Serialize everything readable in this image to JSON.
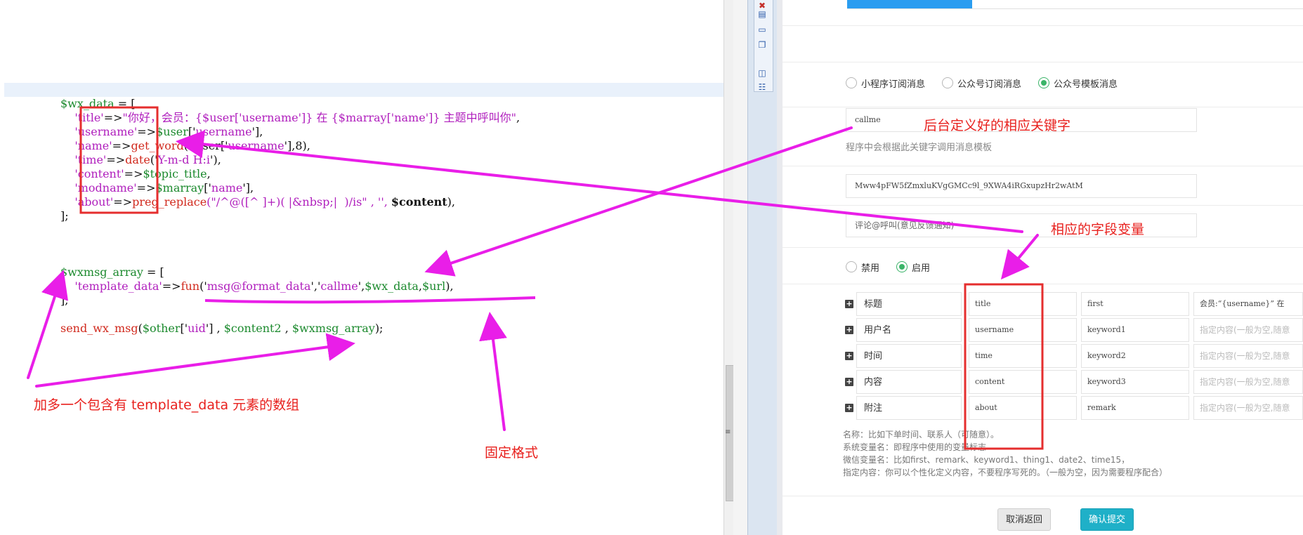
{
  "code": {
    "lines": [
      [
        {
          "t": "$wx_data",
          "c": "c-var"
        },
        {
          "t": " = [",
          "c": "c-op"
        }
      ],
      [
        {
          "t": "    ",
          "c": "c-op"
        },
        {
          "t": "'title'",
          "c": "c-key"
        },
        {
          "t": "=>",
          "c": "c-op"
        },
        {
          "t": "\"你好，会员：{$user['username']} 在 {$marray['name']} 主题中呼叫你\"",
          "c": "c-str"
        },
        {
          "t": ",",
          "c": "c-op"
        }
      ],
      [
        {
          "t": "    ",
          "c": "c-op"
        },
        {
          "t": "'username'",
          "c": "c-key"
        },
        {
          "t": "=>",
          "c": "c-op"
        },
        {
          "t": "$user",
          "c": "c-var"
        },
        {
          "t": "['",
          "c": "c-op"
        },
        {
          "t": "username",
          "c": "c-key"
        },
        {
          "t": "'],",
          "c": "c-op"
        }
      ],
      [
        {
          "t": "    ",
          "c": "c-op"
        },
        {
          "t": "'name'",
          "c": "c-key"
        },
        {
          "t": "=>",
          "c": "c-op"
        },
        {
          "t": "get_word",
          "c": "c-fn"
        },
        {
          "t": "($user['",
          "c": "c-op"
        },
        {
          "t": "username",
          "c": "c-key"
        },
        {
          "t": "'],8),",
          "c": "c-op"
        }
      ],
      [
        {
          "t": "    ",
          "c": "c-op"
        },
        {
          "t": "'time'",
          "c": "c-key"
        },
        {
          "t": "=>",
          "c": "c-op"
        },
        {
          "t": "date",
          "c": "c-fn"
        },
        {
          "t": "('",
          "c": "c-op"
        },
        {
          "t": "Y-m-d H:i",
          "c": "c-key"
        },
        {
          "t": "'),",
          "c": "c-op"
        }
      ],
      [
        {
          "t": "    ",
          "c": "c-op"
        },
        {
          "t": "'content'",
          "c": "c-key"
        },
        {
          "t": "=>",
          "c": "c-op"
        },
        {
          "t": "$topic_title",
          "c": "c-var"
        },
        {
          "t": ",",
          "c": "c-op"
        }
      ],
      [
        {
          "t": "    ",
          "c": "c-op"
        },
        {
          "t": "'modname'",
          "c": "c-key"
        },
        {
          "t": "=>",
          "c": "c-op"
        },
        {
          "t": "$marray",
          "c": "c-var"
        },
        {
          "t": "['",
          "c": "c-op"
        },
        {
          "t": "name",
          "c": "c-key"
        },
        {
          "t": "'],",
          "c": "c-op"
        }
      ],
      [
        {
          "t": "    ",
          "c": "c-op"
        },
        {
          "t": "'about'",
          "c": "c-key"
        },
        {
          "t": "=>",
          "c": "c-op"
        },
        {
          "t": "preg_replace",
          "c": "c-fn"
        },
        {
          "t": "(\"/^@([^ ]+)( |&nbsp;|  )/is\" , '', ",
          "c": "c-str"
        },
        {
          "t": "$content",
          "c": "c-bold"
        },
        {
          "t": "),",
          "c": "c-op"
        }
      ],
      [
        {
          "t": "];",
          "c": "c-op"
        }
      ],
      [],
      [],
      [
        {
          "t": "$wxmsg_array",
          "c": "c-var"
        },
        {
          "t": " = [",
          "c": "c-op"
        }
      ],
      [
        {
          "t": "    ",
          "c": "c-op"
        },
        {
          "t": "'template_data'",
          "c": "c-key"
        },
        {
          "t": "=>",
          "c": "c-op"
        },
        {
          "t": "fun",
          "c": "c-fn"
        },
        {
          "t": "('",
          "c": "c-op"
        },
        {
          "t": "msg@format_data",
          "c": "c-key"
        },
        {
          "t": "','",
          "c": "c-op"
        },
        {
          "t": "callme",
          "c": "c-key"
        },
        {
          "t": "',",
          "c": "c-op"
        },
        {
          "t": "$wx_data",
          "c": "c-var"
        },
        {
          "t": ",",
          "c": "c-op"
        },
        {
          "t": "$url",
          "c": "c-var"
        },
        {
          "t": "),",
          "c": "c-op"
        }
      ],
      [
        {
          "t": "];",
          "c": "c-op"
        }
      ],
      [],
      [
        {
          "t": "send_wx_msg",
          "c": "c-fn"
        },
        {
          "t": "(",
          "c": "c-op"
        },
        {
          "t": "$other",
          "c": "c-var"
        },
        {
          "t": "['",
          "c": "c-op"
        },
        {
          "t": "uid",
          "c": "c-key"
        },
        {
          "t": "'] , ",
          "c": "c-op"
        },
        {
          "t": "$content2",
          "c": "c-var"
        },
        {
          "t": " , ",
          "c": "c-op"
        },
        {
          "t": "$wxmsg_array",
          "c": "c-var"
        },
        {
          "t": ");",
          "c": "c-op"
        }
      ]
    ]
  },
  "toolbar": {
    "icons": [
      "close-doc-icon",
      "clipboard-icon",
      "monitor-icon",
      "copy-icon",
      "window-icon",
      "tree-icon"
    ]
  },
  "form": {
    "msg_types": [
      {
        "label": "小程序订阅消息",
        "checked": false
      },
      {
        "label": "公众号订阅消息",
        "checked": false
      },
      {
        "label": "公众号模板消息",
        "checked": true
      }
    ],
    "keyword_value": "callme",
    "keyword_help": "程序中会根据此关键字调用消息模板",
    "template_id": "Mww4pFW5fZmxluKVgGMCc9l_9XWA4iRGxupzHr2wAtM",
    "template_title": "评论@呼叫(意见反馈通知)",
    "status_options": [
      {
        "label": "禁用",
        "checked": false
      },
      {
        "label": "启用",
        "checked": true
      }
    ],
    "rows": [
      {
        "name": "标题",
        "var": "title",
        "wx": "first",
        "content": "会员:“{username}” 在",
        "content_is_placeholder": false
      },
      {
        "name": "用户名",
        "var": "username",
        "wx": "keyword1",
        "content": "指定内容(一般为空,随意",
        "content_is_placeholder": true
      },
      {
        "name": "时间",
        "var": "time",
        "wx": "keyword2",
        "content": "指定内容(一般为空,随意",
        "content_is_placeholder": true
      },
      {
        "name": "内容",
        "var": "content",
        "wx": "keyword3",
        "content": "指定内容(一般为空,随意",
        "content_is_placeholder": true
      },
      {
        "name": "附注",
        "var": "about",
        "wx": "remark",
        "content": "指定内容(一般为空,随意",
        "content_is_placeholder": true
      }
    ],
    "notes": [
      "名称：比如下单时间、联系人（可随意）。",
      "系统变量名：即程序中使用的变量标志",
      "微信变量名：比如first、remark、keyword1、thing1、date2、time15，",
      "指定内容：你可以个性化定义内容，不要程序写死的。（一般为空，因为需要程序配合）"
    ],
    "cancel_label": "取消返回",
    "submit_label": "确认提交"
  },
  "annotations": {
    "keyword_note": "后台定义好的相应关键字",
    "field_var_note": "相应的字段变量",
    "array_note": "加多一个包含有  template_data   元素的数组",
    "fixed_format_note": "固定格式"
  },
  "colors": {
    "annotation_red": "#e8211e",
    "arrow_magenta": "#e91ee8",
    "box_red": "#e52e2e",
    "accent_green": "#3bb469",
    "submit_teal": "#1fb0c8",
    "tab_blue": "#2a9df0"
  }
}
